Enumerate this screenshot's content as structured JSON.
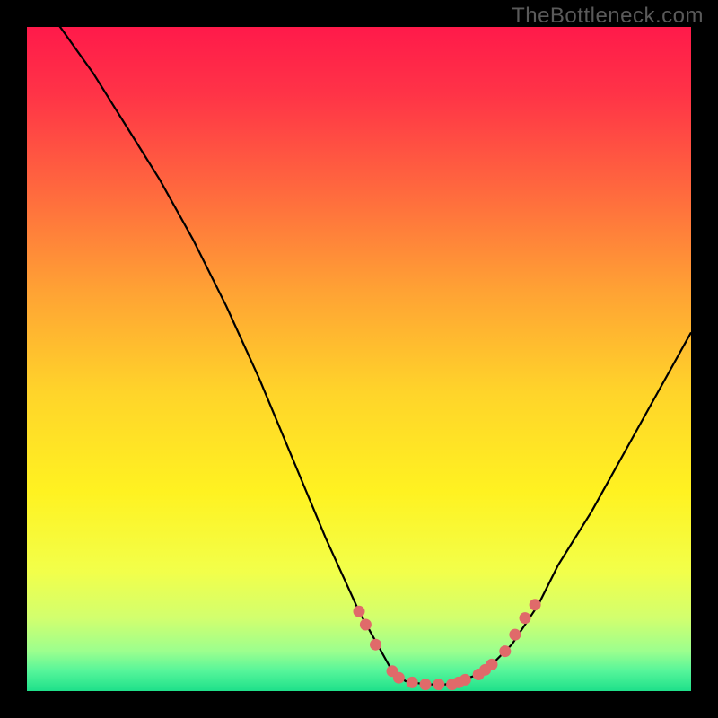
{
  "watermark": "TheBottleneck.com",
  "chart_data": {
    "type": "line",
    "title": "",
    "xlabel": "",
    "ylabel": "",
    "xlim": [
      0,
      100
    ],
    "ylim": [
      0,
      100
    ],
    "curve": {
      "x": [
        0,
        5,
        10,
        15,
        20,
        25,
        30,
        35,
        40,
        45,
        50,
        55,
        57,
        60,
        63,
        65,
        68,
        70,
        73,
        77,
        80,
        85,
        90,
        95,
        100
      ],
      "y": [
        106,
        100,
        93,
        85,
        77,
        68,
        58,
        47,
        35,
        23,
        12,
        3,
        1.5,
        1,
        1,
        1.5,
        2.5,
        4,
        7,
        13,
        19,
        27,
        36,
        45,
        54
      ]
    },
    "markers": {
      "x": [
        50,
        51,
        52.5,
        55,
        56,
        58,
        60,
        62,
        64,
        65,
        66,
        68,
        69,
        70,
        72,
        73.5,
        75,
        76.5
      ],
      "y": [
        12,
        10,
        7,
        3,
        2,
        1.3,
        1,
        1,
        1,
        1.3,
        1.7,
        2.5,
        3.2,
        4,
        6,
        8.5,
        11,
        13
      ]
    },
    "gradient_stops": [
      {
        "offset": 0.0,
        "color": "#ff1a4a"
      },
      {
        "offset": 0.1,
        "color": "#ff3347"
      },
      {
        "offset": 0.25,
        "color": "#ff6a3e"
      },
      {
        "offset": 0.4,
        "color": "#ffa334"
      },
      {
        "offset": 0.55,
        "color": "#ffd42a"
      },
      {
        "offset": 0.7,
        "color": "#fff221"
      },
      {
        "offset": 0.82,
        "color": "#f2ff4a"
      },
      {
        "offset": 0.89,
        "color": "#d2ff6e"
      },
      {
        "offset": 0.94,
        "color": "#9cff8e"
      },
      {
        "offset": 0.97,
        "color": "#55f59a"
      },
      {
        "offset": 1.0,
        "color": "#1ee08a"
      }
    ],
    "marker_color": "#e06a6a",
    "curve_color": "#000000"
  }
}
